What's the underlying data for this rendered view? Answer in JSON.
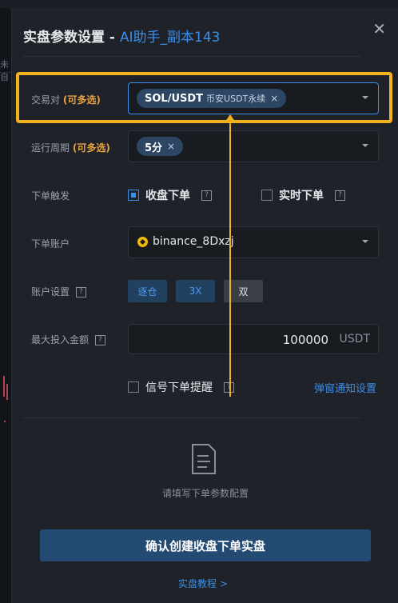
{
  "background": {
    "fragment_text": "未自"
  },
  "modal": {
    "title": "实盘参数设置 - ",
    "title_sub": "AI助手_副本143",
    "close_glyph": "✕"
  },
  "form": {
    "trading_pair": {
      "label": "交易对",
      "label_opt": "(可多选)",
      "tag_symbol": "SOL/USDT",
      "tag_exchange": "币安USDT永续",
      "tag_remove": "×"
    },
    "period": {
      "label": "运行周期",
      "label_opt": "(可多选)",
      "tag_value": "5分",
      "tag_remove": "×"
    },
    "trigger": {
      "label": "下单触发",
      "option_close": "收盘下单",
      "option_close_checked": true,
      "option_realtime": "实时下单",
      "option_realtime_checked": false,
      "help": "?"
    },
    "account": {
      "label": "下单账户",
      "value": "binance_8Dxzj",
      "icon": "binance-icon"
    },
    "account_settings": {
      "label": "账户设置",
      "help": "?",
      "margin_mode": "逐仓",
      "leverage": "3X",
      "position_mode": "双"
    },
    "max_amount": {
      "label": "最大投入金额",
      "help": "?",
      "value": "100000",
      "unit": "USDT"
    },
    "signal_alert": {
      "label": "信号下单提醒",
      "checked": false,
      "help": "?",
      "link": "弹窗通知设置"
    }
  },
  "empty_state": {
    "icon": "document-icon",
    "text": "请填写下单参数配置"
  },
  "confirm_button": "确认创建收盘下单实盘",
  "tutorial_link": "实盘教程 >",
  "colors": {
    "accent": "#3b8fe8",
    "highlight": "#f2b21d",
    "label_opt": "#e8a33c"
  }
}
